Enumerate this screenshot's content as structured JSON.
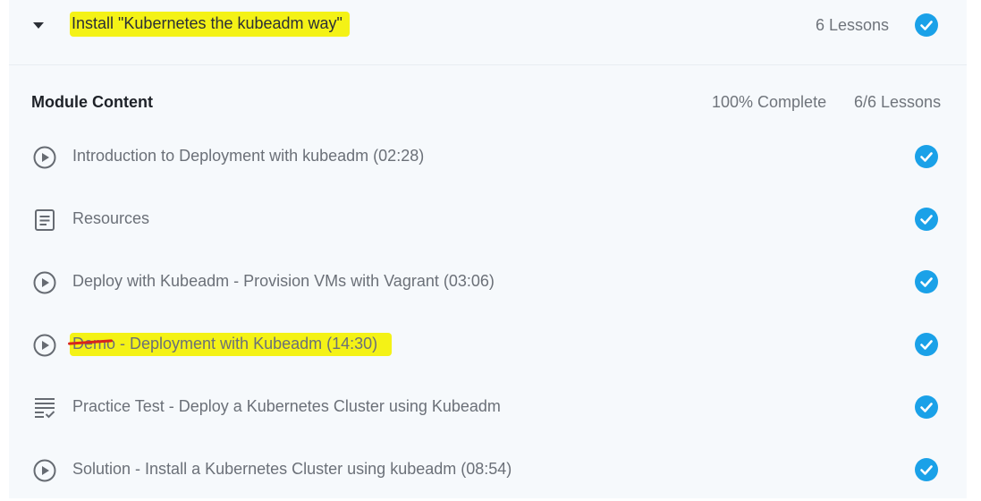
{
  "module": {
    "title": "Install \"Kubernetes the kubeadm way\"",
    "lessons_count": "6 Lessons"
  },
  "content": {
    "heading": "Module Content",
    "percent_complete": "100% Complete",
    "lessons_done": "6/6 Lessons"
  },
  "lessons": [
    {
      "icon": "play-circle-icon",
      "label": "Introduction to Deployment with kubeadm (02:28)",
      "completed": true
    },
    {
      "icon": "document-icon",
      "label": "Resources",
      "completed": true
    },
    {
      "icon": "play-circle-icon",
      "label": "Deploy with Kubeadm - Provision VMs with Vagrant (03:06)",
      "completed": true
    },
    {
      "icon": "play-circle-icon",
      "label": "Demo - Deployment with Kubeadm (14:30)",
      "completed": true
    },
    {
      "icon": "checklist-icon",
      "label": "Practice Test - Deploy a Kubernetes Cluster using Kubeadm",
      "completed": true
    },
    {
      "icon": "play-circle-icon",
      "label": "Solution - Install a Kubernetes Cluster using kubeadm (08:54)",
      "completed": true
    }
  ],
  "colors": {
    "accent": "#1aa1e8",
    "highlight": "#f4f216",
    "strike": "#d9241c"
  }
}
